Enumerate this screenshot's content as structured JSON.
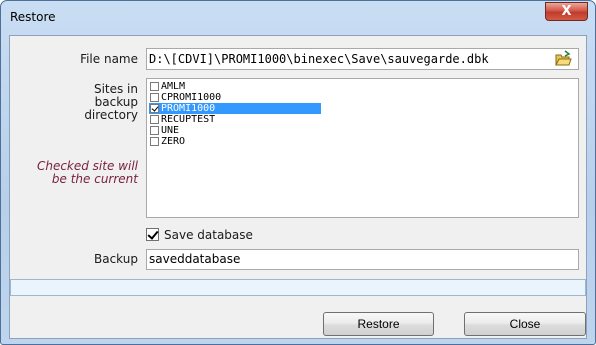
{
  "window": {
    "title": "Restore",
    "close_glyph": "X"
  },
  "file": {
    "label": "File name",
    "value": "D:\\[CDVI]\\PROMI1000\\binexec\\Save\\sauvegarde.dbk",
    "browse_icon": "folder-open-icon"
  },
  "sites": {
    "label_lines": [
      "Sites in",
      "backup",
      "directory"
    ],
    "note_lines": [
      "Checked site will",
      "be the current"
    ],
    "items": [
      {
        "name": "AMLM",
        "checked": false,
        "selected": false
      },
      {
        "name": "CPROMI1000",
        "checked": false,
        "selected": false
      },
      {
        "name": "PROMI1000",
        "checked": true,
        "selected": true
      },
      {
        "name": "RECUPTEST",
        "checked": false,
        "selected": false
      },
      {
        "name": "UNE",
        "checked": false,
        "selected": false
      },
      {
        "name": "ZERO",
        "checked": false,
        "selected": false
      }
    ]
  },
  "save_database": {
    "label": "Save database",
    "checked": true
  },
  "backup": {
    "label": "Backup",
    "value": "saveddatabase"
  },
  "buttons": {
    "restore": "Restore",
    "close": "Close"
  },
  "colors": {
    "selection": "#3399ff",
    "note_text": "#7b2240",
    "status_bar": "#eaf4fc"
  }
}
